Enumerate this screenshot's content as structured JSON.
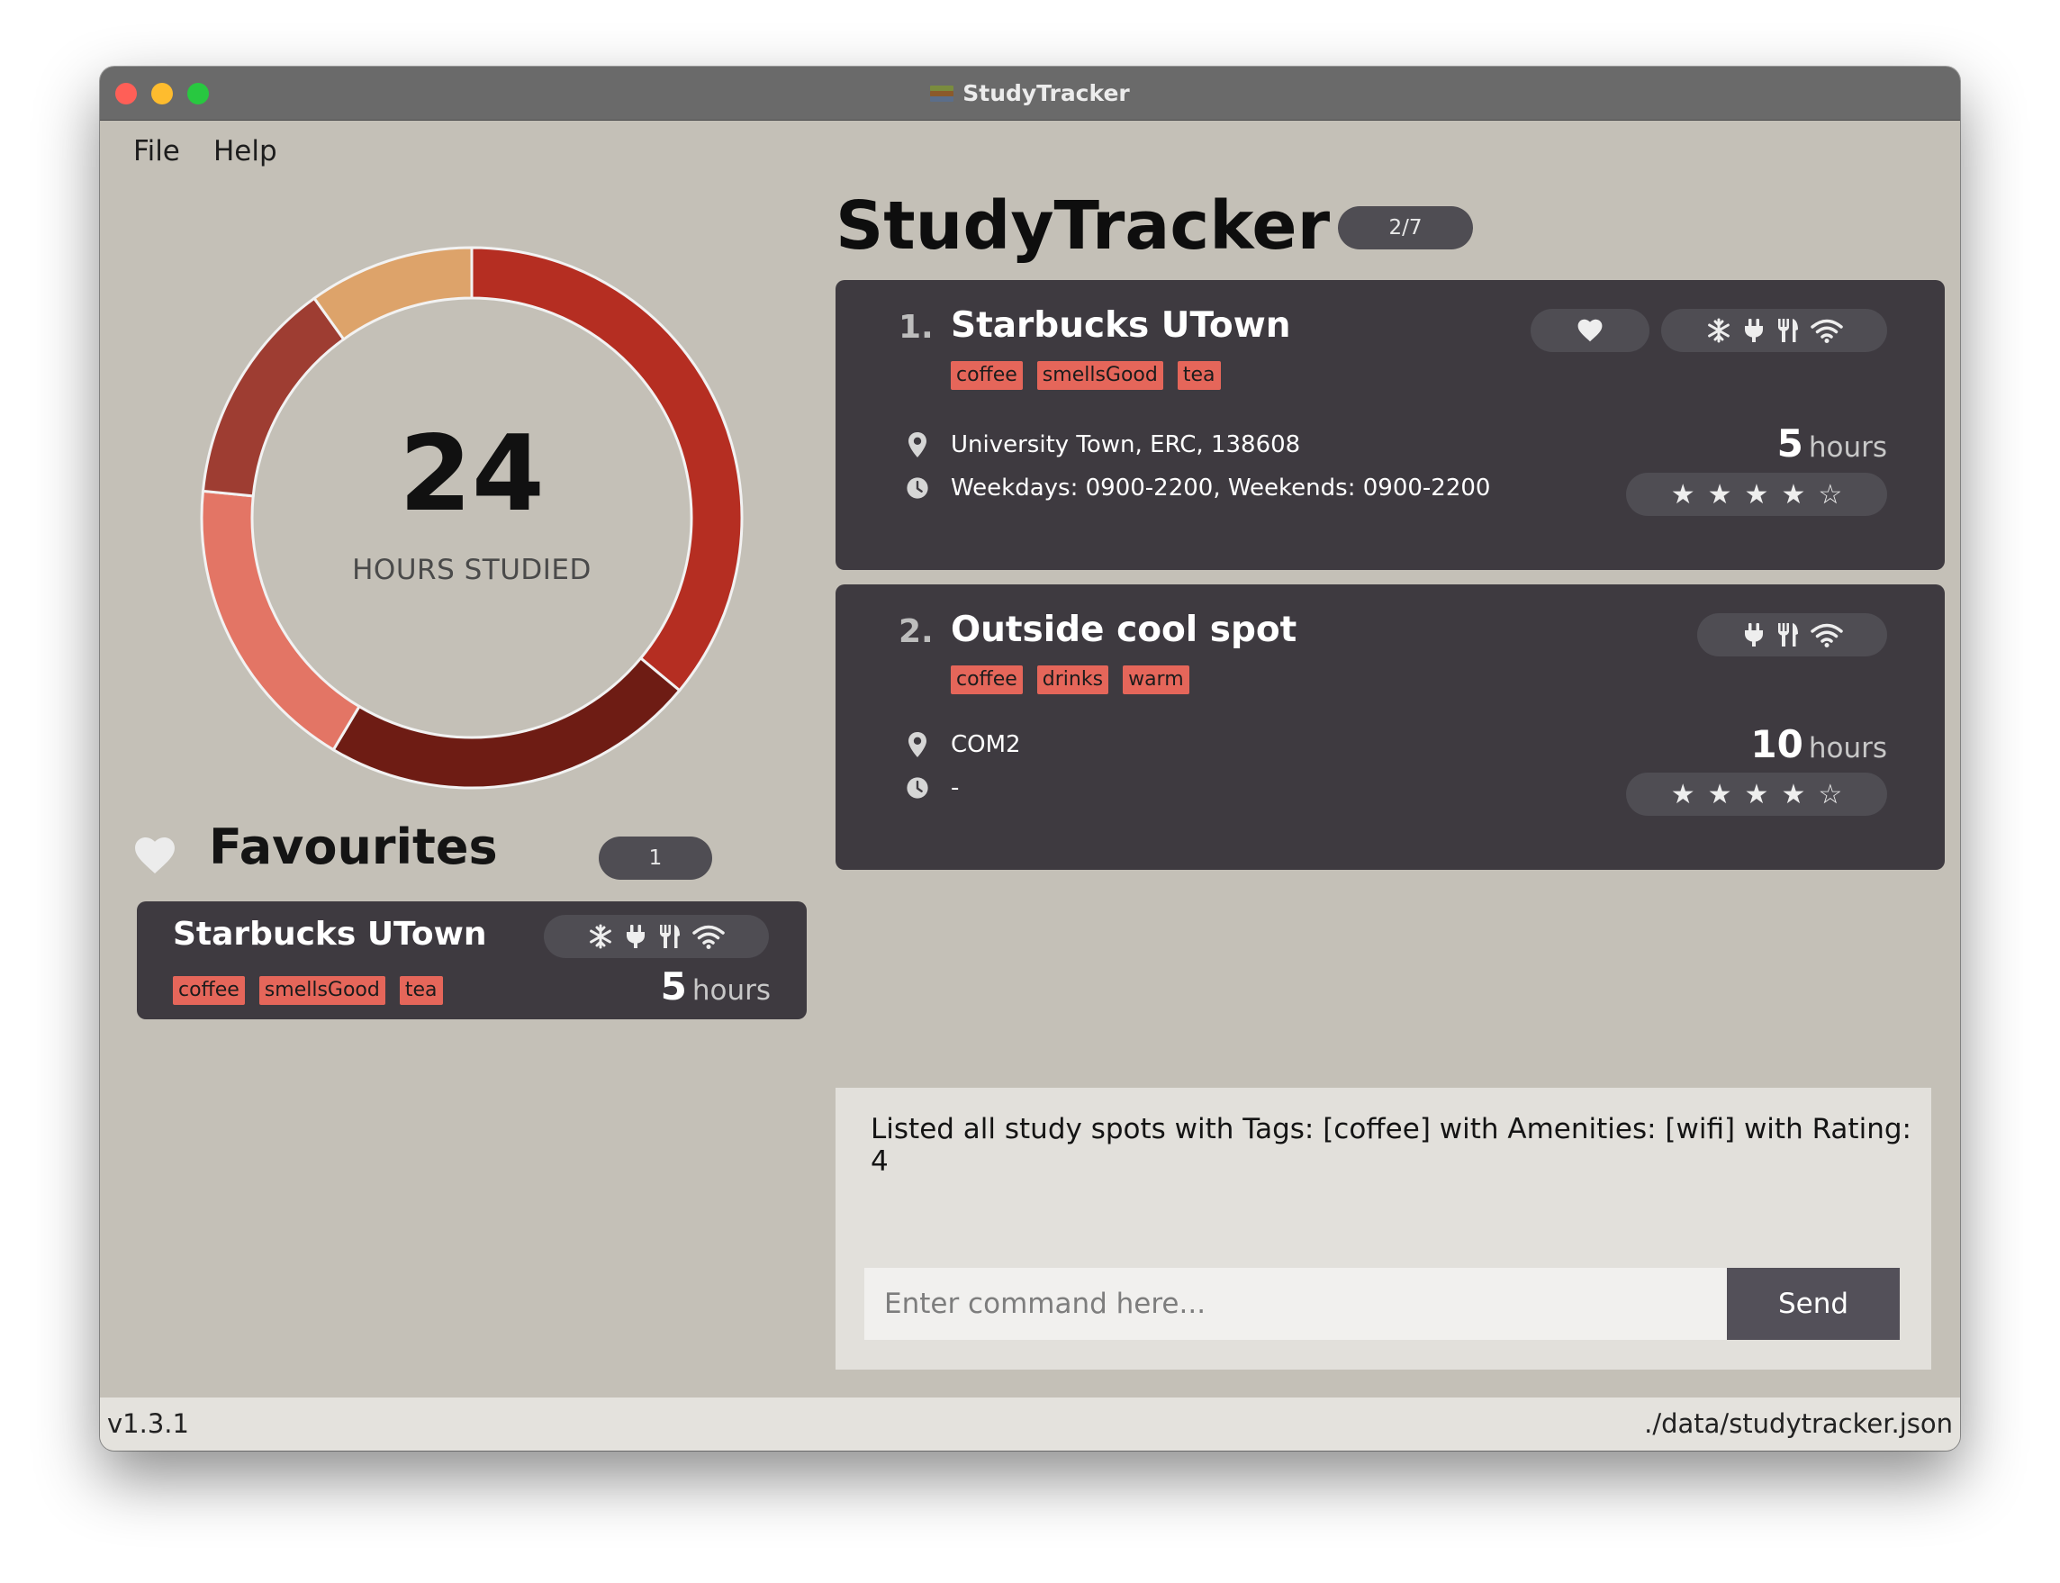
{
  "window": {
    "title": "StudyTracker",
    "icon": "books-icon"
  },
  "menu": {
    "file": "File",
    "help": "Help"
  },
  "donut": {
    "total": "24",
    "label": "HOURS STUDIED",
    "segments": [
      {
        "value": 8,
        "color": "#b52e22"
      },
      {
        "value": 5,
        "color": "#6e1c14"
      },
      {
        "value": 4,
        "color": "#e37565"
      },
      {
        "value": 3,
        "color": "#9e3d32"
      },
      {
        "value": 2.2,
        "color": "#dda36a"
      }
    ]
  },
  "favourites": {
    "title": "Favourites",
    "count": "1",
    "items": [
      {
        "name": "Starbucks UTown",
        "tags": [
          "coffee",
          "smellsGood",
          "tea"
        ],
        "amenities": [
          "snowflake-icon",
          "plug-icon",
          "utensils-icon",
          "wifi-icon"
        ],
        "hours_value": "5",
        "hours_unit": "hours"
      }
    ]
  },
  "main": {
    "title": "StudyTracker",
    "page_indicator": "2/7",
    "spots": [
      {
        "index": "1.",
        "name": "Starbucks UTown",
        "tags": [
          "coffee",
          "smellsGood",
          "tea"
        ],
        "favourite": true,
        "amenities": [
          "snowflake-icon",
          "plug-icon",
          "utensils-icon",
          "wifi-icon"
        ],
        "address": "University Town, ERC, 138608",
        "opening_hours": "Weekdays: 0900-2200, Weekends: 0900-2200",
        "hours_value": "5",
        "hours_unit": "hours",
        "rating": 4,
        "rating_max": 5
      },
      {
        "index": "2.",
        "name": "Outside cool spot",
        "tags": [
          "coffee",
          "drinks",
          "warm"
        ],
        "favourite": false,
        "amenities": [
          "plug-icon",
          "utensils-icon",
          "wifi-icon"
        ],
        "address": "COM2",
        "opening_hours": "-",
        "hours_value": "10",
        "hours_unit": "hours",
        "rating": 4,
        "rating_max": 5
      }
    ]
  },
  "result": {
    "message": "Listed all study spots with Tags: [coffee] with Amenities: [wifi] with Rating: 4"
  },
  "command": {
    "placeholder": "Enter command here...",
    "value": "",
    "send_label": "Send"
  },
  "status": {
    "version": "v1.3.1",
    "file_path": "./data/studytracker.json"
  },
  "colors": {
    "background": "#c4c0b7",
    "card": "#3e3a40",
    "pill": "#4f4d53",
    "tag": "#e5665a"
  }
}
